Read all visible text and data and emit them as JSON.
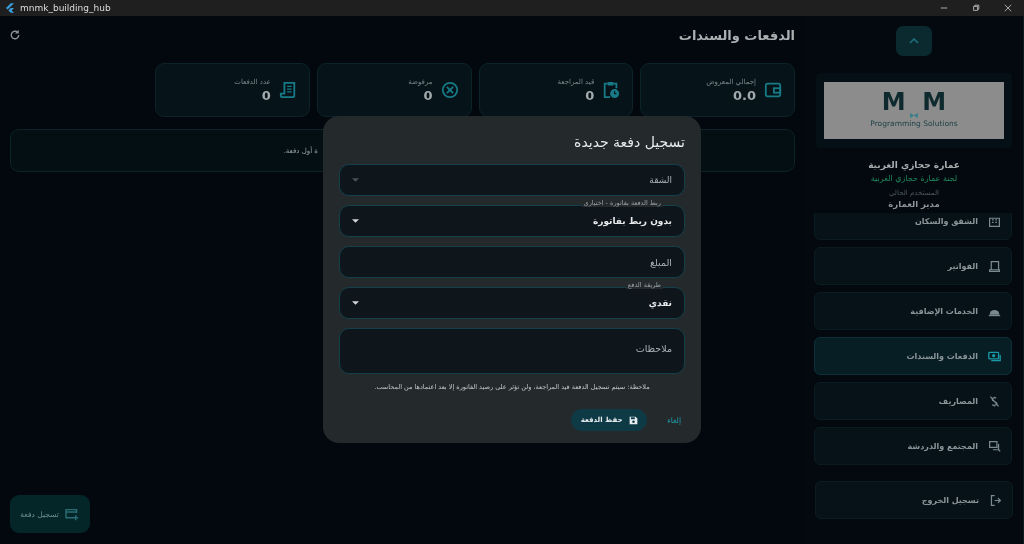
{
  "window": {
    "title": "mnmk_building_hub"
  },
  "page": {
    "title": "الدفعات والسندات"
  },
  "stats": [
    {
      "kind": "wallet",
      "label": "إجمالي المعروض",
      "value": "0.0"
    },
    {
      "kind": "pending",
      "label": "قيد المراجعة",
      "value": "0"
    },
    {
      "kind": "rejected",
      "label": "مرفوضة",
      "value": "0"
    },
    {
      "kind": "count",
      "label": "عدد الدفعات",
      "value": "0"
    }
  ],
  "empty_message": "ة أول دفعة.",
  "fab": {
    "label": "تسجيل دفعة"
  },
  "sidebar": {
    "logo": {
      "wordmark": "M  M",
      "tagline": "Programming Solutions"
    },
    "building": "عمارة حجازي الغربية",
    "committee": "لجنة عمارة حجازي الغربية",
    "user_caption": "المستخدم الحالي",
    "user_role": "مدير العمارة",
    "items": [
      {
        "kind": "apartments",
        "label": "الشقق والسكان",
        "selected": false
      },
      {
        "kind": "invoices",
        "label": "الفواتير",
        "selected": false
      },
      {
        "kind": "services",
        "label": "الخدمات الإضافية",
        "selected": false
      },
      {
        "kind": "payments",
        "label": "الدفعات والسندات",
        "selected": true
      },
      {
        "kind": "expenses",
        "label": "المصاريف",
        "selected": false
      },
      {
        "kind": "community",
        "label": "المجتمع والدردشة",
        "selected": false
      }
    ],
    "logout": "تسجيل الخروج"
  },
  "dialog": {
    "title": "تسجيل دفعة جديدة",
    "fields": [
      {
        "kind": "dropdown",
        "placeholder": "الشقة",
        "disabled": true
      },
      {
        "kind": "dropdown",
        "label": "ربط الدفعة بفاتورة - اختياري",
        "value": "بدون ربط بفاتورة",
        "disabled": false
      },
      {
        "kind": "text",
        "placeholder": "المبلغ"
      },
      {
        "kind": "dropdown",
        "label": "طريقة الدفع",
        "value": "نقدي",
        "disabled": false
      },
      {
        "kind": "textarea",
        "placeholder": "ملاحظات"
      }
    ],
    "note": "ملاحظة: سيتم تسجيل الدفعة قيد المراجعة، ولن تؤثر على رصيد الفاتورة إلا بعد اعتمادها من المحاسب.",
    "cancel": "إلغاء",
    "save": "حفظ الدفعة"
  }
}
